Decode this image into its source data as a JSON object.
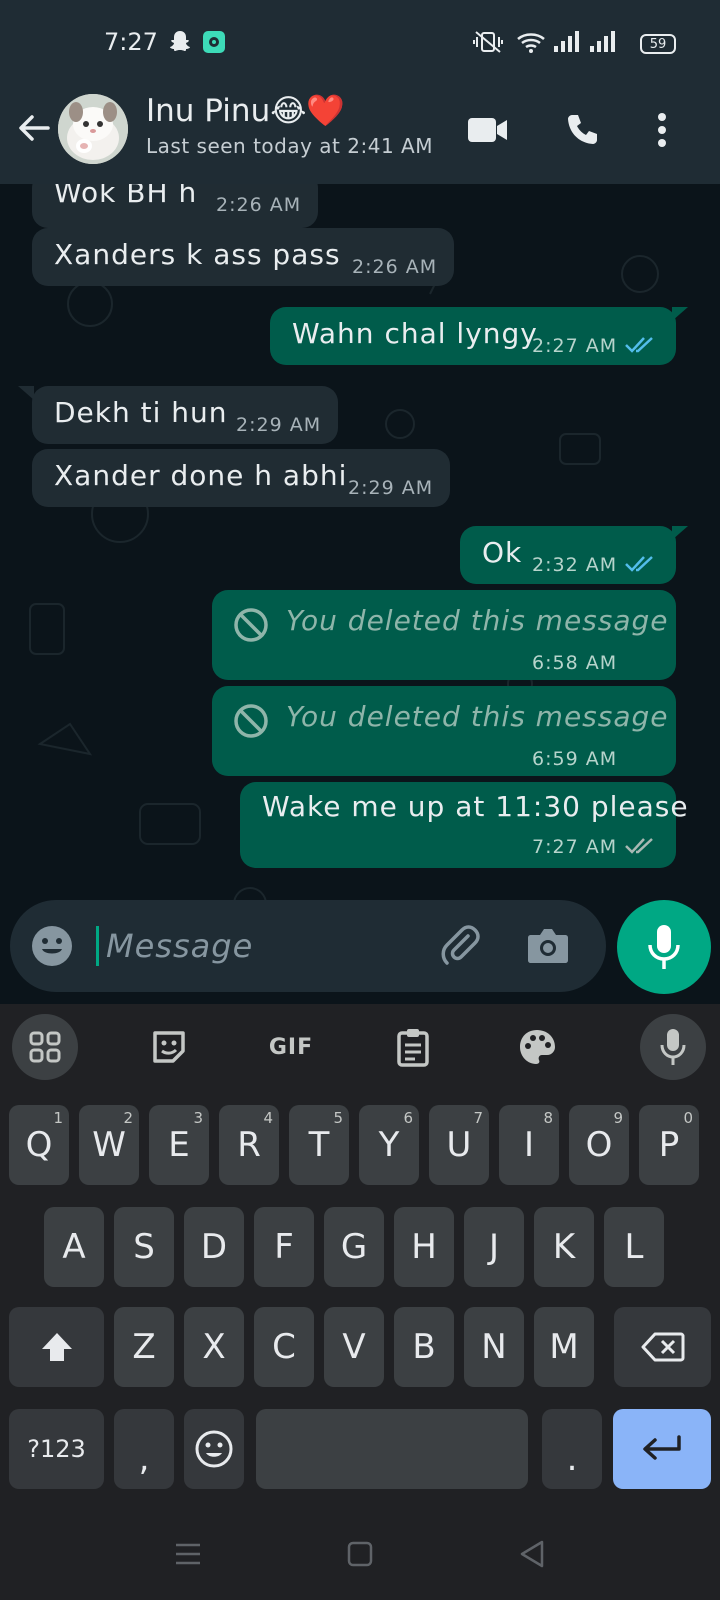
{
  "status_bar": {
    "time": "7:27",
    "battery": "59",
    "icons": [
      "snapchat-icon",
      "app-notification-icon",
      "vibrate-off-icon",
      "wifi-icon",
      "signal-icon",
      "signal-icon-2"
    ]
  },
  "header": {
    "contact_name": "Inu Pinu😂❤️",
    "last_seen": "Last seen today at 2:41 AM",
    "icons": [
      "back-arrow-icon",
      "video-call-icon",
      "voice-call-icon",
      "more-options-icon"
    ]
  },
  "messages": [
    {
      "direction": "in",
      "text": "Wok BH h",
      "time": "2:26 AM"
    },
    {
      "direction": "in",
      "text": "Xanders k ass pass",
      "time": "2:26 AM"
    },
    {
      "direction": "out",
      "text": "Wahn chal lyngy",
      "time": "2:27 AM",
      "status": "read"
    },
    {
      "direction": "in",
      "text": "Dekh ti hun",
      "time": "2:29 AM"
    },
    {
      "direction": "in",
      "text": "Xander done h abhi",
      "time": "2:29 AM"
    },
    {
      "direction": "out",
      "text": "Ok",
      "time": "2:32 AM",
      "status": "read"
    },
    {
      "direction": "out",
      "text": "You deleted this message",
      "time": "6:58 AM",
      "deleted": true
    },
    {
      "direction": "out",
      "text": "You deleted this message",
      "time": "6:59 AM",
      "deleted": true
    },
    {
      "direction": "out",
      "text": "Wake me up at 11:30 please",
      "time": "7:27 AM",
      "status": "delivered"
    }
  ],
  "compose": {
    "placeholder": "Message",
    "icons": [
      "emoji-icon",
      "attach-icon",
      "camera-icon",
      "mic-icon"
    ]
  },
  "keyboard": {
    "toolbar": {
      "gif_label": "GIF",
      "icons": [
        "apps-grid-icon",
        "sticker-icon",
        "clipboard-icon",
        "theme-palette-icon",
        "voice-input-icon"
      ]
    },
    "row1": [
      {
        "key": "Q",
        "hint": "1"
      },
      {
        "key": "W",
        "hint": "2"
      },
      {
        "key": "E",
        "hint": "3"
      },
      {
        "key": "R",
        "hint": "4"
      },
      {
        "key": "T",
        "hint": "5"
      },
      {
        "key": "Y",
        "hint": "6"
      },
      {
        "key": "U",
        "hint": "7"
      },
      {
        "key": "I",
        "hint": "8"
      },
      {
        "key": "O",
        "hint": "9"
      },
      {
        "key": "P",
        "hint": "0"
      }
    ],
    "row2": [
      "A",
      "S",
      "D",
      "F",
      "G",
      "H",
      "J",
      "K",
      "L"
    ],
    "row3": [
      "Z",
      "X",
      "C",
      "V",
      "B",
      "N",
      "M"
    ],
    "symbols_label": "?123",
    "comma": ",",
    "period": "."
  },
  "colors": {
    "outgoing_bubble": "#005c4b",
    "incoming_bubble": "#202c33",
    "accent": "#00a884",
    "read_ticks": "#53bdeb",
    "enter_key": "#8ab4f8"
  }
}
